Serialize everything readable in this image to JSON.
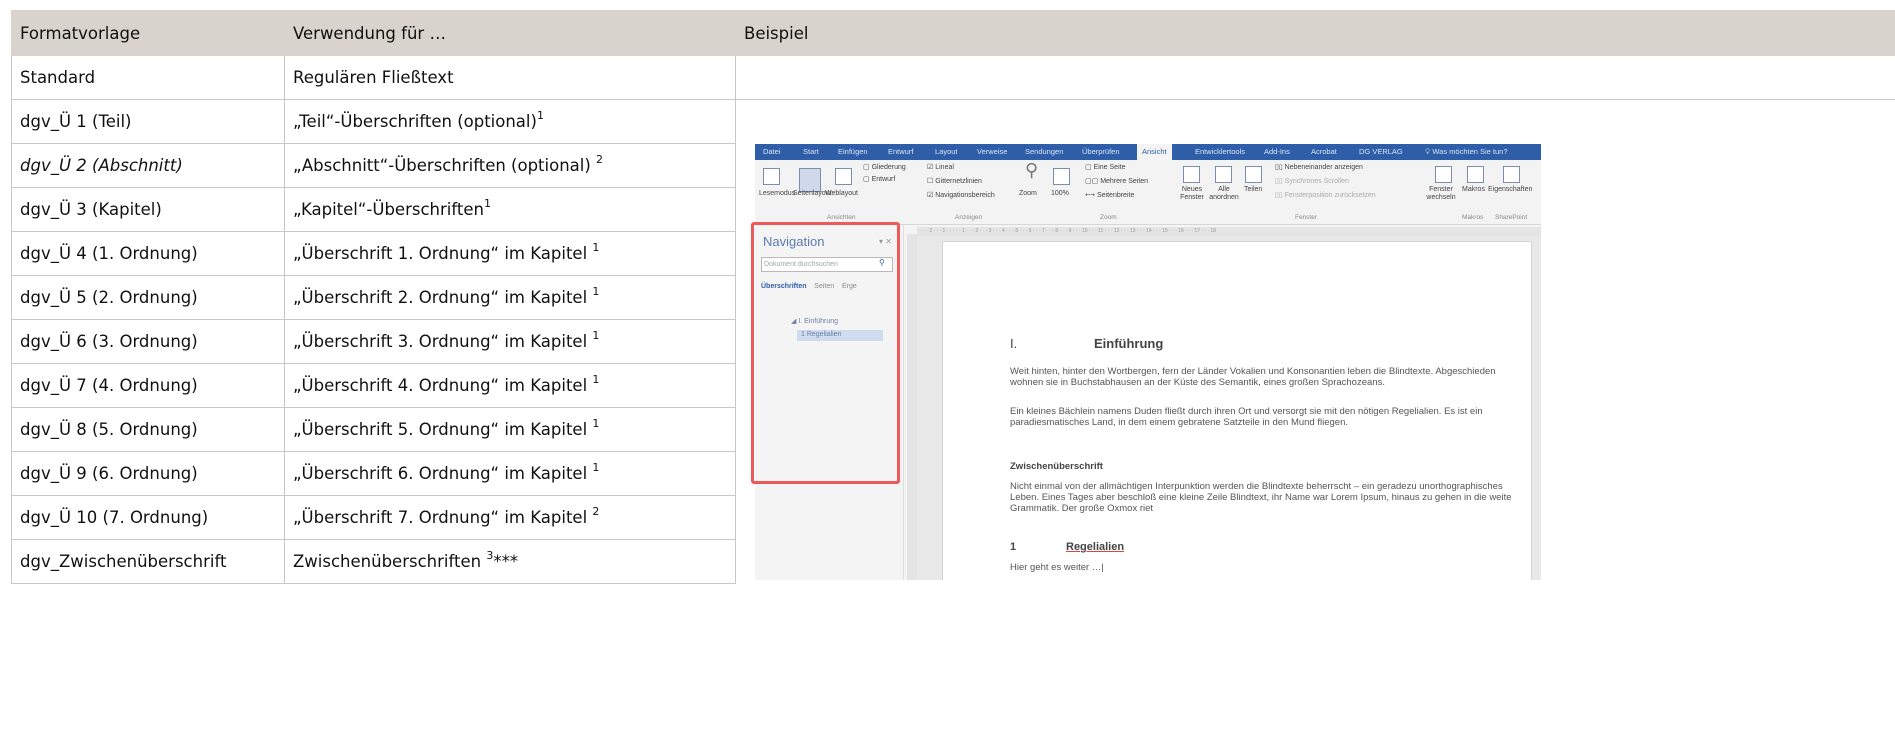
{
  "table": {
    "headers": [
      "Formatvorlage",
      "Verwendung für …",
      "Beispiel"
    ],
    "rows": [
      {
        "style": "Standard",
        "use": "Regulären Fließtext",
        "sup": ""
      },
      {
        "style": "dgv_Ü 1 (Teil)",
        "use": "„Teil“-Überschriften (optional)",
        "sup": "1"
      },
      {
        "style": "dgv_Ü 2 (Abschnitt)",
        "use": "„Abschnitt“-Überschriften (optional) ",
        "sup": "2"
      },
      {
        "style": "dgv_Ü 3 (Kapitel)",
        "use": "„Kapitel“-Überschriften",
        "sup": "1"
      },
      {
        "style": "dgv_Ü 4 (1. Ordnung)",
        "use": "„Überschrift 1. Ordnung“ im Kapitel ",
        "sup": "1"
      },
      {
        "style": "dgv_Ü 5 (2. Ordnung)",
        "use": "„Überschrift 2. Ordnung“ im Kapitel ",
        "sup": "1"
      },
      {
        "style": "dgv_Ü 6 (3. Ordnung)",
        "use": "„Überschrift 3. Ordnung“ im Kapitel ",
        "sup": "1"
      },
      {
        "style": "dgv_Ü 7 (4. Ordnung)",
        "use": "„Überschrift 4. Ordnung“ im Kapitel ",
        "sup": "1"
      },
      {
        "style": "dgv_Ü 8 (5. Ordnung)",
        "use": "„Überschrift 5. Ordnung“ im Kapitel ",
        "sup": "1"
      },
      {
        "style": "dgv_Ü 9 (6. Ordnung)",
        "use": "„Überschrift 6. Ordnung“ im Kapitel ",
        "sup": "1"
      },
      {
        "style": "dgv_Ü 10 (7. Ordnung)",
        "use": "„Überschrift 7. Ordnung“ im Kapitel ",
        "sup": "2"
      },
      {
        "style": "dgv_Zwischenüberschrift",
        "use": "Zwischenüberschriften ",
        "sup": "3",
        "suffix": "***"
      }
    ]
  },
  "word": {
    "tabs": [
      "Datei",
      "Start",
      "Einfügen",
      "Entwurf",
      "Layout",
      "Verweise",
      "Sendungen",
      "Überprüfen",
      "Ansicht",
      "Entwicklertools",
      "Add-Ins",
      "Acrobat",
      "DG VERLAG",
      "Was möchten Sie tun?"
    ],
    "ribbon": {
      "lesemodus": "Lesemodus",
      "seitenlayout": "Seitenlayout",
      "weblayout": "Weblayout",
      "gliederung": "Gliederung",
      "entwurf": "Entwurf",
      "lineal": "Lineal",
      "gitternetzlinien": "Gitternetzlinien",
      "navigationsbereich": "Navigationsbereich",
      "zoom": "Zoom",
      "zoom100": "100%",
      "eine_seite": "Eine Seite",
      "mehrere_seiten": "Mehrere Seiten",
      "seitenbreite": "Seitenbreite",
      "neues_fenster": "Neues Fenster",
      "alle_anordnen": "Alle anordnen",
      "teilen": "Teilen",
      "nebeneinander": "Nebeneinander anzeigen",
      "synchron": "Synchrones Scrollen",
      "fensterposition": "Fensterposition zurücksetzen",
      "fenster_wechseln": "Fenster wechseln",
      "makros": "Makros",
      "eigenschaften": "Eigenschaften",
      "groups": [
        "Ansichten",
        "Anzeigen",
        "Zoom",
        "Fenster",
        "Makros",
        "SharePoint"
      ]
    },
    "nav": {
      "title": "Navigation",
      "search_placeholder": "Dokument durchsuchen",
      "tabs": [
        "Überschriften",
        "Seiten",
        "Erge"
      ],
      "items": [
        "I. Einführung",
        "1 Regelialien"
      ]
    },
    "doc": {
      "h1_num": "I.",
      "h1": "Einführung",
      "p1": "Weit hinten, hinter den Wortbergen, fern der Länder Vokalien und Konsonantien leben die Blindtexte. Abgeschieden wohnen sie in Buchstabhausen an der Küste des Semantik, eines großen Sprachozeans.",
      "p2": "Ein kleines Bächlein namens Duden fließt durch ihren Ort und versorgt sie mit den nötigen Regelialien. Es ist ein paradiesmatisches Land, in dem einem gebratene Satzteile in den Mund fliegen.",
      "h2": "Zwischenüberschrift",
      "p3": "Nicht einmal von der allmächtigen Interpunktion werden die Blindtexte beherrscht – ein geradezu unorthographisches Leben. Eines Tages aber beschloß eine kleine Zeile Blindtext, ihr Name war Lorem Ipsum, hinaus zu gehen in die weite Grammatik. Der große Oxmox riet",
      "h3_num": "1",
      "h3": "Regelialien",
      "p4": "Hier geht es weiter …|"
    }
  }
}
